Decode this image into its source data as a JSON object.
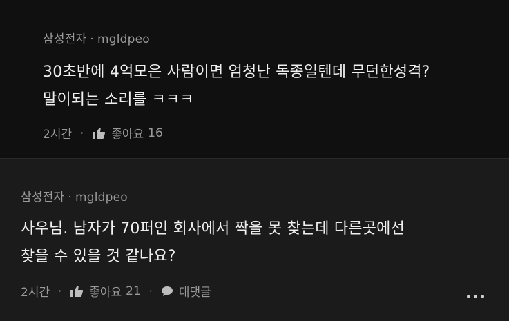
{
  "comments": [
    {
      "channel": "삼성전자",
      "username": "mgldpeo",
      "lines": [
        "30초반에 4억모은 사람이면 엄청난 독종일텐데 무던한성격?",
        "말이되는 소리를 ㅋㅋㅋ"
      ],
      "time": "2시간",
      "like_label": "좋아요",
      "like_count": "16"
    },
    {
      "channel": "삼성전자",
      "username": "mgldpeo",
      "lines": [
        "사우님. 남자가 70퍼인 회사에서 짝을 못 찾는데 다른곳에선",
        "찾을 수 있을 것 같나요?"
      ],
      "time": "2시간",
      "like_label": "좋아요",
      "like_count": "21",
      "reply_label": "대댓글"
    }
  ],
  "separator": "·",
  "icons": {
    "like": "thumbs-up-icon",
    "reply": "speech-bubble-icon",
    "more": "more-options-icon"
  },
  "colors": {
    "background_top": "#101010",
    "background_bottom": "#1b1b1b",
    "text": "#efefef",
    "meta": "#9a9a9a"
  }
}
